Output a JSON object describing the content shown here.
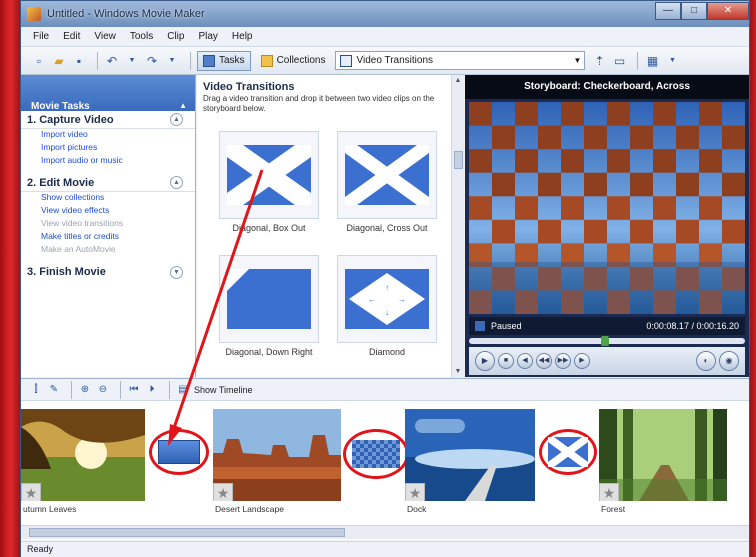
{
  "window": {
    "title": "Untitled - Windows Movie Maker",
    "controls": [
      "—",
      "□",
      "✕"
    ]
  },
  "menu": [
    "File",
    "Edit",
    "View",
    "Tools",
    "Clip",
    "Play",
    "Help"
  ],
  "toolbar": {
    "tasks_label": "Tasks",
    "collections_label": "Collections",
    "collection_select": "Video Transitions"
  },
  "tasks_pane": {
    "header": "Movie Tasks",
    "sections": [
      {
        "title": "1. Capture Video",
        "links": [
          {
            "label": "Import video",
            "enabled": true
          },
          {
            "label": "Import pictures",
            "enabled": true
          },
          {
            "label": "Import audio or music",
            "enabled": true
          }
        ]
      },
      {
        "title": "2. Edit Movie",
        "links": [
          {
            "label": "Show collections",
            "enabled": true
          },
          {
            "label": "View video effects",
            "enabled": true
          },
          {
            "label": "View video transitions",
            "enabled": false
          },
          {
            "label": "Make titles or credits",
            "enabled": true
          },
          {
            "label": "Make an AutoMovie",
            "enabled": false
          }
        ]
      },
      {
        "title": "3. Finish Movie",
        "links": []
      }
    ]
  },
  "content": {
    "title": "Video Transitions",
    "description": "Drag a video transition and drop it between two video clips on the storyboard below.",
    "transitions": [
      {
        "name": "Diagonal, Box Out"
      },
      {
        "name": "Diagonal, Cross Out"
      },
      {
        "name": "Diagonal, Down Right"
      },
      {
        "name": "Diamond"
      }
    ]
  },
  "preview": {
    "title": "Storyboard: Checkerboard, Across",
    "status": "Paused",
    "time": "0:00:08.17 / 0:00:16.20"
  },
  "storyboard": {
    "show_timeline_label": "Show Timeline",
    "clips": [
      {
        "label": "utumn Leaves"
      },
      {
        "label": "Desert Landscape"
      },
      {
        "label": "Dock"
      },
      {
        "label": "Forest"
      }
    ]
  },
  "status_bar": {
    "text": "Ready"
  },
  "colors": {
    "annotation_red": "#e1141a",
    "task_header": "#3a6bbc",
    "link_blue": "#1f4fd1"
  }
}
